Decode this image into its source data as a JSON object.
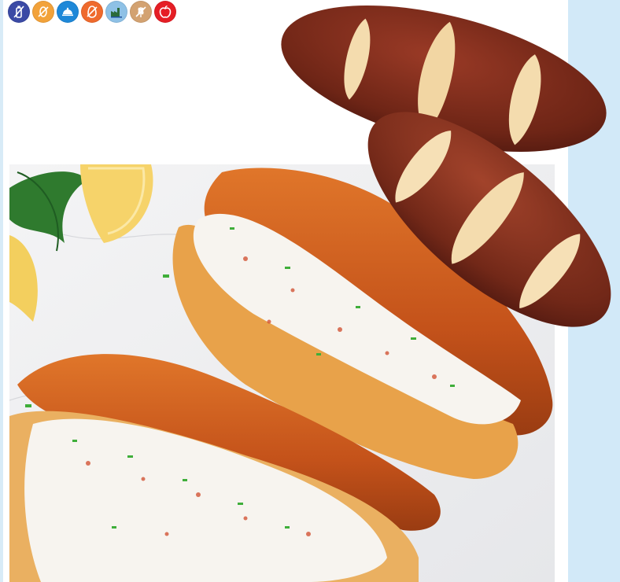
{
  "colors": {
    "page_background": "#ffffff",
    "side_panel": "#d2e9f8",
    "pretzel_crust": "#c8541a",
    "pretzel_dark": "#6e2516",
    "crumb": "#f4dcae"
  },
  "badges": [
    {
      "name": "no-dairy-badge",
      "icon": "bottle-slash-icon",
      "color": "#3b4aa5"
    },
    {
      "name": "no-nuts-badge",
      "icon": "nut-slash-icon",
      "color": "#f2a23a"
    },
    {
      "name": "foodservice-badge",
      "icon": "cloche-icon",
      "color": "#1e88d8"
    },
    {
      "name": "no-egg-badge",
      "icon": "egg-slash-icon",
      "color": "#ef6a2d"
    },
    {
      "name": "bakery-badge",
      "icon": "factory-icon",
      "color": "#8ec1e6"
    },
    {
      "name": "no-gluten-badge",
      "icon": "wheat-slash-icon",
      "color": "#d3a271"
    },
    {
      "name": "healthy-badge",
      "icon": "apple-icon",
      "color": "#e51e25"
    }
  ]
}
